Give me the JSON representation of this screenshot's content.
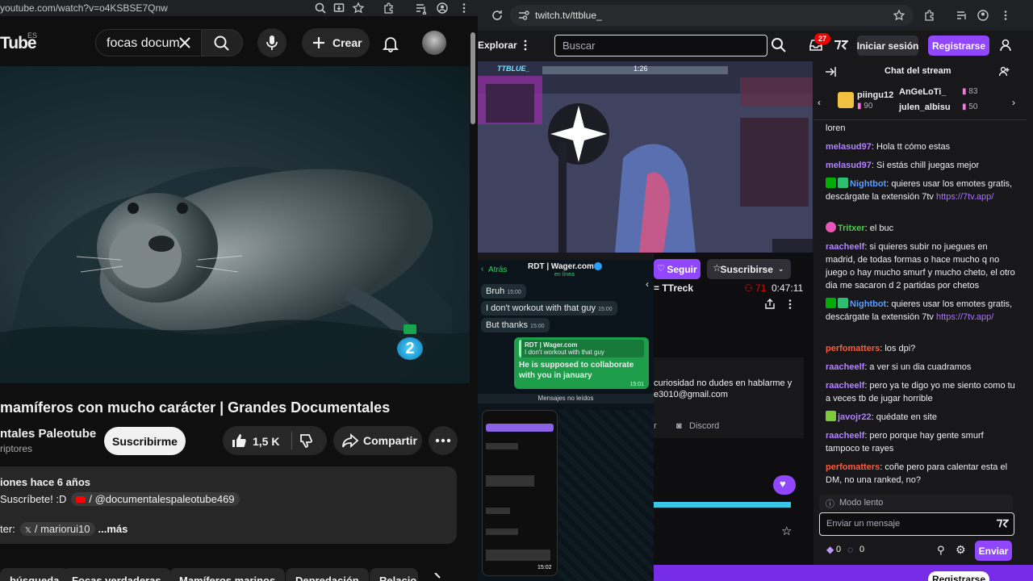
{
  "youtube": {
    "url": "youtube.com/watch?v=o4KSBSE7Qnw",
    "logo": "Tube",
    "region": "ES",
    "search_value": "focas docum",
    "create_label": "Crear",
    "video_title": "mamíferos con mucho carácter | Grandes Documentales",
    "channel_name": "ntales Paleotube",
    "subscribers": "riptores",
    "subscribe_label": "Suscribirme",
    "likes": "1,5 K",
    "share_label": "Compartir",
    "channel_logo_text": "2",
    "desc_line1": "iones  hace 6 años",
    "desc_line2_a": "Suscríbete! :D",
    "desc_line2_b": "/ @documentalespaleotube469",
    "desc_line3_a": "ter:",
    "desc_line3_b": "/ mariorui10",
    "desc_more": "...más",
    "chips": [
      "búsqueda",
      "Focas verdaderas",
      "Mamíferos marinos",
      "Depredación",
      "Relacio"
    ]
  },
  "twitch": {
    "url": "twitch.tv/ttblue_",
    "explore_label": "Explorar",
    "search_placeholder": "Buscar",
    "notif_count": "27",
    "login_label": "Iniciar sesión",
    "register_label": "Registrarse",
    "chat_title": "Chat del stream",
    "gifters": [
      {
        "name": "piingu12",
        "count": "90"
      },
      {
        "name": "AnGeLoTi_",
        "count": "83"
      },
      {
        "name": "julen_albisu",
        "count": "50"
      }
    ],
    "follow_label": "Seguir",
    "subscribe_label": "Suscribirse",
    "channel_snip": "= TTreck",
    "viewers": "71",
    "uptime": "0:47:11",
    "about_line1": "curiosidad no dudes en hablarme y",
    "about_line2": "e3010@gmail.com",
    "discord_label": "Discord",
    "discord_prefix": "r",
    "chat_messages": [
      {
        "user": "",
        "text": "loren",
        "color": "#efeff1"
      },
      {
        "user": "melasud97",
        "text": ": Hola tt cómo estas",
        "color": "#b383ff"
      },
      {
        "user": "melasud97",
        "text": ": Si estás chill juegas mejor",
        "color": "#b383ff"
      },
      {
        "user": "Nightbot",
        "text": ": quieres usar los emotes gratis, descárgate la extensión 7tv ",
        "link": "https://7tv.app/",
        "color": "#5b9bff"
      },
      {
        "user": "Tritxer",
        "text": ": el buc",
        "color": "#4ec94e"
      },
      {
        "user": "raacheelf",
        "text": ": si quieres subir no juegues en madrid, de todas formas o hace mucho q no juego o hay mucho smurf y mucho cheto, el otro dia me sacaron d 2 partidas por chetos",
        "color": "#b383ff"
      },
      {
        "user": "Nightbot",
        "text": ": quieres usar los emotes gratis, descárgate la extensión 7tv ",
        "link": "https://7tv.app/",
        "color": "#5b9bff"
      },
      {
        "user": "perfomatters",
        "text": ": los dpi?",
        "color": "#ff5a3c"
      },
      {
        "user": "raacheelf",
        "text": ": a ver si un dia cuadramos",
        "color": "#b383ff"
      },
      {
        "user": "raacheelf",
        "text": ": pero ya te digo yo me siento como tu a veces tb de jugar horrible",
        "color": "#b383ff"
      },
      {
        "user": "javojr22",
        "text": ": quédate en site",
        "color": "#b383ff"
      },
      {
        "user": "raacheelf",
        "text": ": pero porque hay gente smurf tampoco te rayes",
        "color": "#b383ff"
      },
      {
        "user": "perfomatters",
        "text": ": coñe pero para calentar esta el DM, no una ranked, no?",
        "color": "#ff5a3c"
      }
    ],
    "slow_mode": "Modo lento",
    "chat_placeholder": "Enviar un mensaje",
    "points_a": "0",
    "points_b": "0",
    "send_label": "Enviar",
    "bottom_register": "Registrarse"
  },
  "whatsapp": {
    "back_label": "Atrás",
    "contact": "RDT | Wager.com",
    "status": "en línea",
    "messages": [
      {
        "text": "Bruh",
        "time": "15:00"
      },
      {
        "text": "I don't workout with that guy",
        "time": "15:00"
      },
      {
        "text": "But thanks",
        "time": "15:00"
      }
    ],
    "reply_quote_name": "RDT | Wager.com",
    "reply_quote_text": "I don't workout with that guy",
    "reply_text": "He is supposed to collaborate with you in january",
    "reply_time": "15:01",
    "unread_label": "Mensajes no leídos",
    "phone_time": "15:02"
  },
  "stream_overlay": {
    "brand": "TTBLUE_",
    "score": "1:26"
  }
}
